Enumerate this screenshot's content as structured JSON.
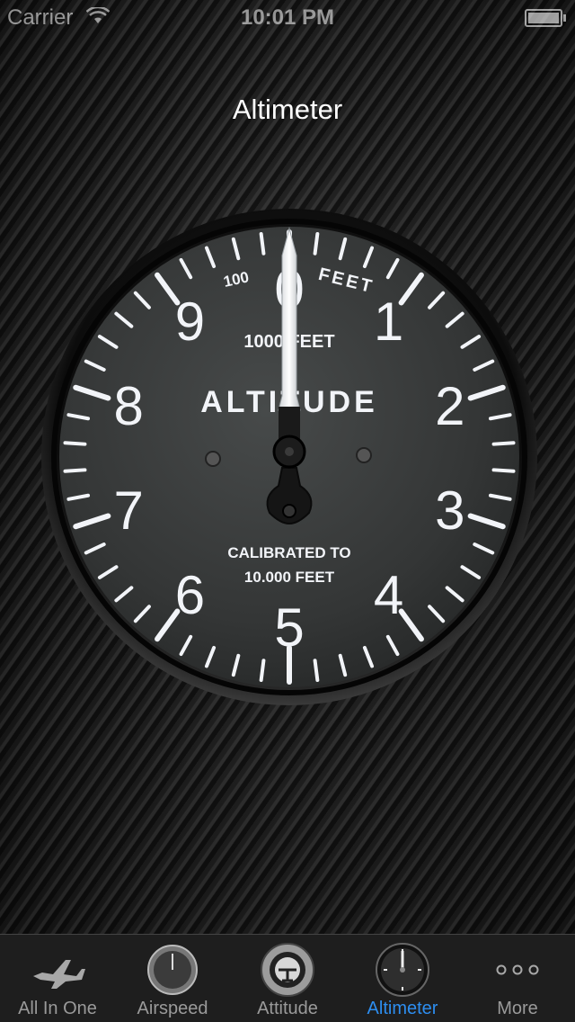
{
  "status_bar": {
    "carrier": "Carrier",
    "time": "10:01 PM",
    "wifi_icon": "wifi-icon",
    "battery_icon": "battery-icon"
  },
  "page_title": "Altimeter",
  "gauge": {
    "numerals": [
      "0",
      "1",
      "2",
      "3",
      "4",
      "5",
      "6",
      "7",
      "8",
      "9"
    ],
    "top_left_label": "100",
    "top_right_label": "FEET",
    "upper_label": "1000 FEET",
    "center_label": "ALTITUDE",
    "lower_label_1": "CALIBRATED TO",
    "lower_label_2": "10.000 FEET",
    "needle_value": 0
  },
  "tabs": [
    {
      "label": "All In One",
      "icon": "airplane-icon",
      "active": false
    },
    {
      "label": "Airspeed",
      "icon": "airspeed-gauge-icon",
      "active": false
    },
    {
      "label": "Attitude",
      "icon": "attitude-gauge-icon",
      "active": false
    },
    {
      "label": "Altimeter",
      "icon": "altimeter-gauge-icon",
      "active": true
    },
    {
      "label": "More",
      "icon": "more-dots-icon",
      "active": false
    }
  ],
  "colors": {
    "accent": "#2d8ef0",
    "tab_inactive": "#9a9a9a",
    "dial_face": "#3a3c3c",
    "marking": "#f2f4f8"
  }
}
